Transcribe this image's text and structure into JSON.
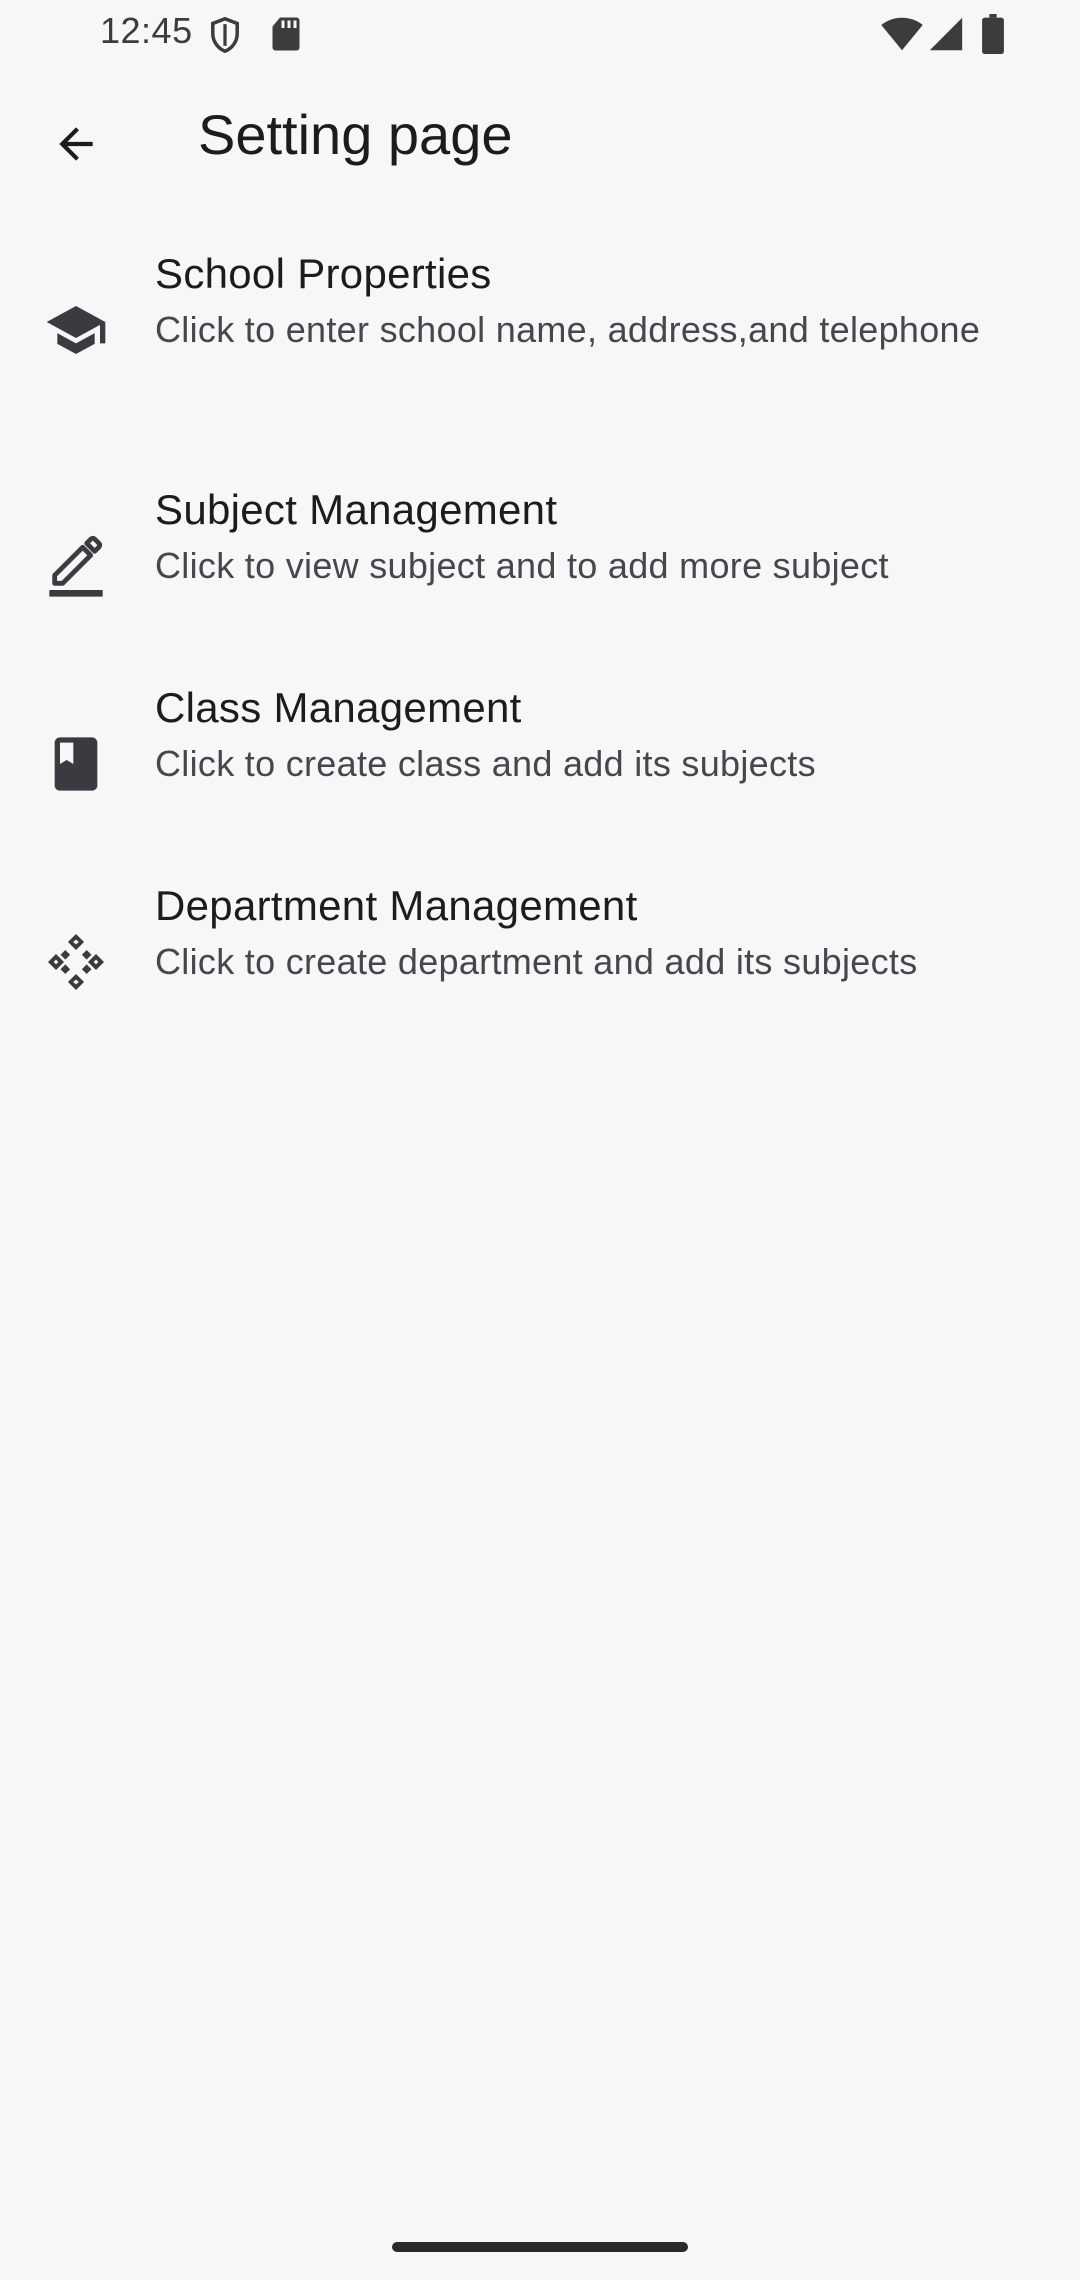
{
  "status_bar": {
    "time": "12:45",
    "icons": [
      "shield-icon",
      "sd-card-icon",
      "wifi-icon",
      "signal-icon",
      "battery-icon"
    ]
  },
  "app_bar": {
    "back_icon": "arrow-back-icon",
    "title": "Setting page"
  },
  "settings": [
    {
      "icon": "school-icon",
      "title": "School Properties",
      "subtitle": "Click to enter school name, address,and telephone"
    },
    {
      "icon": "edit-pen-icon",
      "title": "Subject Management",
      "subtitle": "Click to view subject and to add more subject"
    },
    {
      "icon": "book-icon",
      "title": "Class Management",
      "subtitle": "Click to create class and add its subjects"
    },
    {
      "icon": "workspaces-icon",
      "title": "Department Management",
      "subtitle": "Click to create department and add its subjects"
    }
  ],
  "colors": {
    "background": "#f7f7f7",
    "text_primary": "#1c1b1f",
    "text_secondary": "#49454f",
    "icon": "#3b3a40"
  }
}
